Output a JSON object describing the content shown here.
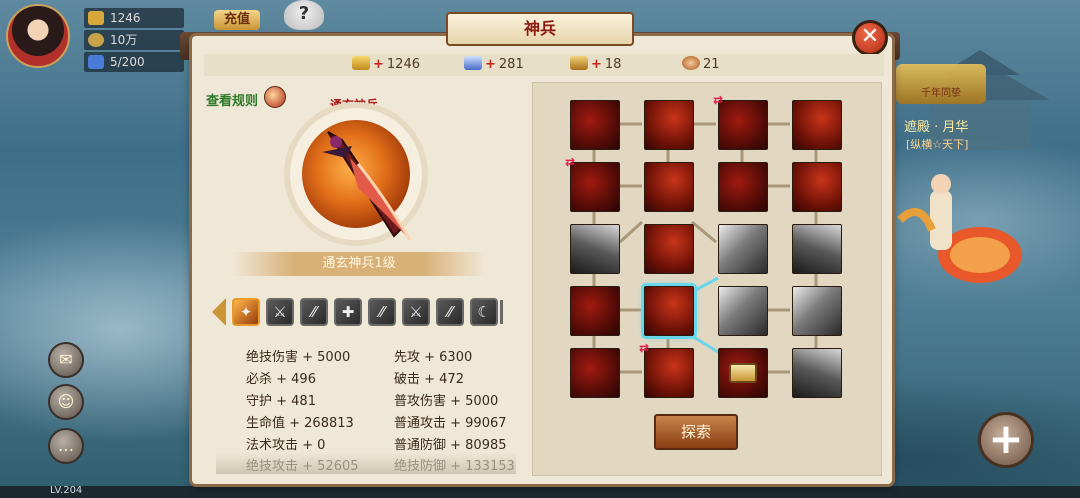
{
  "hud": {
    "gold": "1246",
    "silver": "10万",
    "stamina": "5/200",
    "recharge_label": "充值",
    "help_label": "?"
  },
  "level_label": "LV.204",
  "npc": {
    "banner": "千年同挚",
    "name": "遮殿 · 月华",
    "subtitle": "[纵横☆天下]"
  },
  "dialog": {
    "title": "神兵",
    "close_label": "✕",
    "resources": [
      {
        "icon": "gold-ingot-icon",
        "value": "1246",
        "plus": "+"
      },
      {
        "icon": "crystal-icon",
        "value": "281",
        "plus": "+"
      },
      {
        "icon": "token-icon",
        "value": "18",
        "plus": "+"
      },
      {
        "icon": "seal-icon",
        "value": "21",
        "plus": ""
      }
    ],
    "rules_label": "查看规则",
    "weapon": {
      "name_top": "通玄神兵",
      "level_label": "通玄神兵1级"
    },
    "skills": [
      "✦",
      "⚔",
      "⁄⁄",
      "✚",
      "⁄⁄",
      "⚔",
      "⁄⁄",
      "☾"
    ],
    "stats_left": [
      "绝技伤害 + 5000",
      "必杀 + 496",
      "守护 + 481",
      "生命值 + 268813",
      "法术攻击 + 0",
      "绝技攻击 + 52605"
    ],
    "stats_right": [
      "先攻 + 6300",
      "破击 + 472",
      "普攻伤害 + 5000",
      "普通攻击 + 99067",
      "普通防御 + 80985",
      "绝技防御 + 133153"
    ],
    "explore_label": "探索"
  },
  "colors": {
    "accent_red": "#a81a1a",
    "link_green": "#2e7a2a",
    "selection_cyan": "#6ad6ea"
  }
}
